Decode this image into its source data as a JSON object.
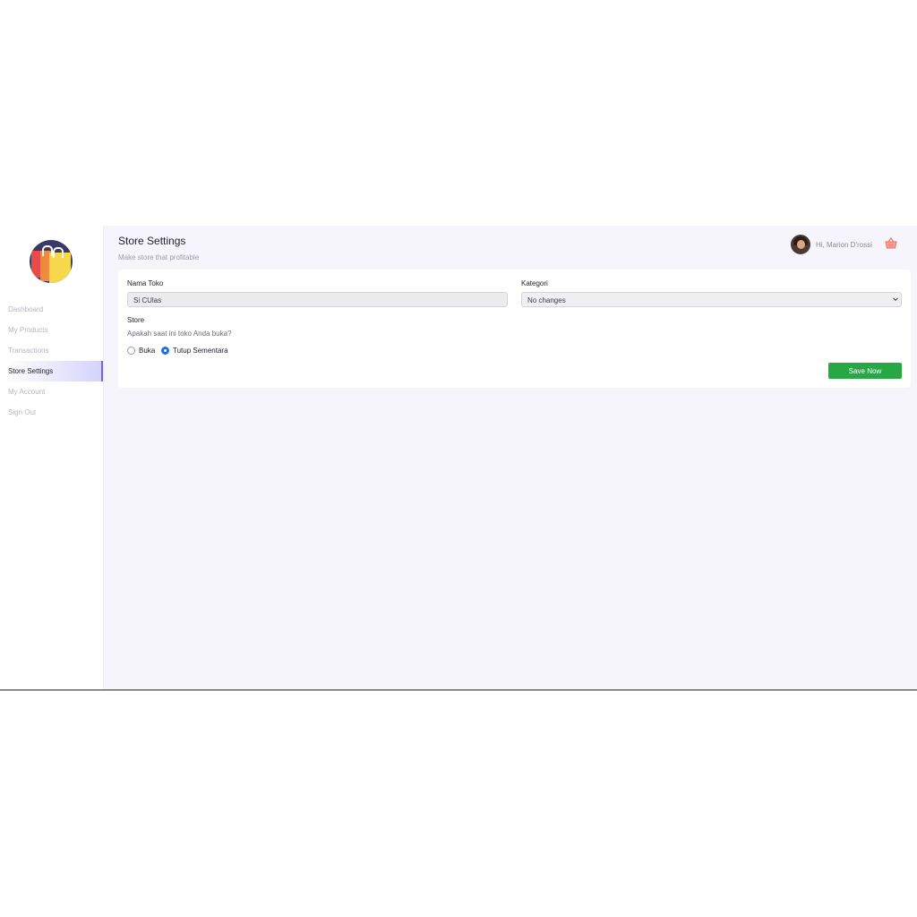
{
  "sidebar": {
    "logo": "shopping-bags-logo",
    "items": [
      {
        "label": "Dashboard",
        "active": false
      },
      {
        "label": "My Products",
        "active": false
      },
      {
        "label": "Transactions",
        "active": false
      },
      {
        "label": "Store Settings",
        "active": true
      },
      {
        "label": "My Account",
        "active": false
      },
      {
        "label": "Sign Out",
        "active": false
      }
    ]
  },
  "header": {
    "title": "Store Settings",
    "subtitle": "Make store that profitable",
    "greeting": "Hi, Marion D'rossi",
    "cart_icon": "basket-icon"
  },
  "form": {
    "store_name_label": "Nama Toko",
    "store_name_value": "Si CUlas",
    "category_label": "Kategori",
    "category_selected": "No changes",
    "store_label": "Store",
    "store_question": "Apakah saat ini toko Anda buka?",
    "options": [
      {
        "label": "Buka",
        "checked": false
      },
      {
        "label": "Tutup Sementara",
        "checked": true
      }
    ],
    "save_label": "Save Now"
  },
  "colors": {
    "accent": "#6f66e8",
    "save_button": "#28a745",
    "radio_selected": "#1f6fe5",
    "background": "#f5f5fb"
  }
}
